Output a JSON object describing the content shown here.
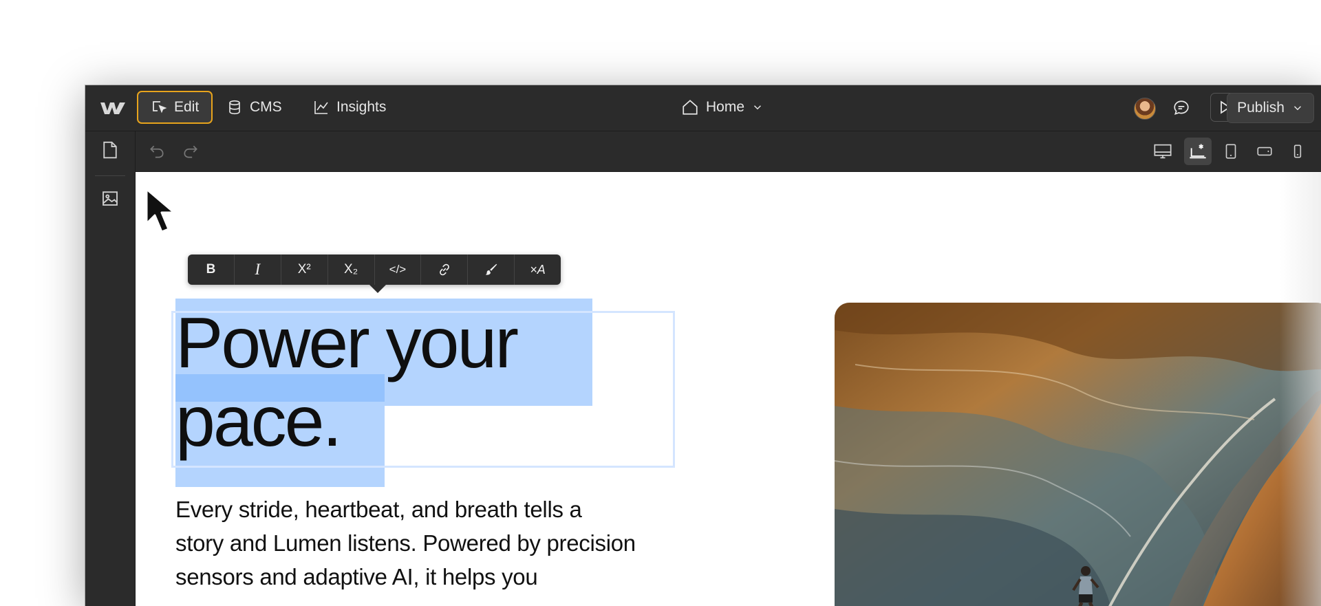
{
  "topbar": {
    "modes": [
      {
        "label": "Edit",
        "icon": "cursor-select-icon",
        "active": true
      },
      {
        "label": "CMS",
        "icon": "database-icon"
      },
      {
        "label": "Insights",
        "icon": "line-chart-icon"
      }
    ],
    "page_selector": {
      "label": "Home",
      "icon": "home-icon"
    },
    "publish_label": "Publish"
  },
  "sidebar": {
    "items": [
      {
        "icon": "page-icon"
      },
      {
        "icon": "assets-icon"
      }
    ]
  },
  "toolbar": {
    "history": [
      "undo-icon",
      "redo-icon"
    ],
    "breakpoints": [
      "desktop-icon",
      "base-breakpoint-icon",
      "tablet-icon",
      "mobile-landscape-icon",
      "mobile-portrait-icon"
    ],
    "active_breakpoint": "base-breakpoint-icon"
  },
  "rich_text_toolbar": {
    "buttons": [
      "B",
      "I",
      "X²",
      "X₂",
      "</>",
      "link",
      "brush",
      "×A"
    ]
  },
  "canvas": {
    "heading_lines": [
      "Power your",
      "pace."
    ],
    "body_lines": [
      "Every stride, heartbeat, and breath tells a",
      "story and Lumen listens. Powered by precision",
      "sensors and adaptive AI, it helps you"
    ]
  },
  "colors": {
    "chrome": "#2b2b2b",
    "edit_accent": "#e8a41c",
    "selection": "#b4d4fe",
    "selection_dark": "#94c2fd",
    "heading_outline": "#d4e5ff"
  }
}
